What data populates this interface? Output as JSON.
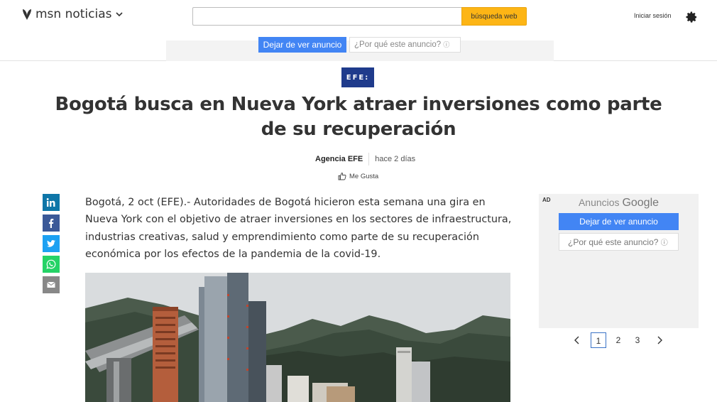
{
  "header": {
    "logo_text": "msn noticias",
    "search_placeholder": "",
    "search_button": "búsqueda web",
    "signin": "Iniciar sesión",
    "settings_icon": "gear-icon"
  },
  "top_ad": {
    "stop_label": "Dejar de ver anuncio",
    "why_label": "¿Por qué este anuncio?",
    "info_glyph": "ⓘ"
  },
  "article": {
    "source_logo": "EFE:",
    "title": "Bogotá busca en Nueva York atraer inversiones como parte de su recuperación",
    "source": "Agencia EFE",
    "time": "hace 2 días",
    "like": "Me Gusta",
    "body": "Bogotá, 2 oct (EFE).- Autoridades de Bogotá hicieron esta semana una gira en Nueva York con el objetivo de atraer inversiones en los sectores de infraestructura, industrias creativas, salud y emprendimiento como parte de su recuperación económica por los efectos de la pandemia de la covid-19."
  },
  "share": [
    {
      "name": "linkedin",
      "color": "#0e76a8",
      "icon": "linkedin-icon"
    },
    {
      "name": "facebook",
      "color": "#3b5998",
      "icon": "facebook-icon"
    },
    {
      "name": "twitter",
      "color": "#1da1f2",
      "icon": "twitter-icon"
    },
    {
      "name": "whatsapp",
      "color": "#25d366",
      "icon": "whatsapp-icon"
    },
    {
      "name": "email",
      "color": "#888888",
      "icon": "email-icon"
    }
  ],
  "side_ad": {
    "ad_label": "AD",
    "ads_by": "Anuncios",
    "google": "Google",
    "stop_label": "Dejar de ver anuncio",
    "why_label": "¿Por qué este anuncio?",
    "info_glyph": "ⓘ"
  },
  "pager": {
    "pages": [
      "1",
      "2",
      "3"
    ],
    "current": "1"
  }
}
